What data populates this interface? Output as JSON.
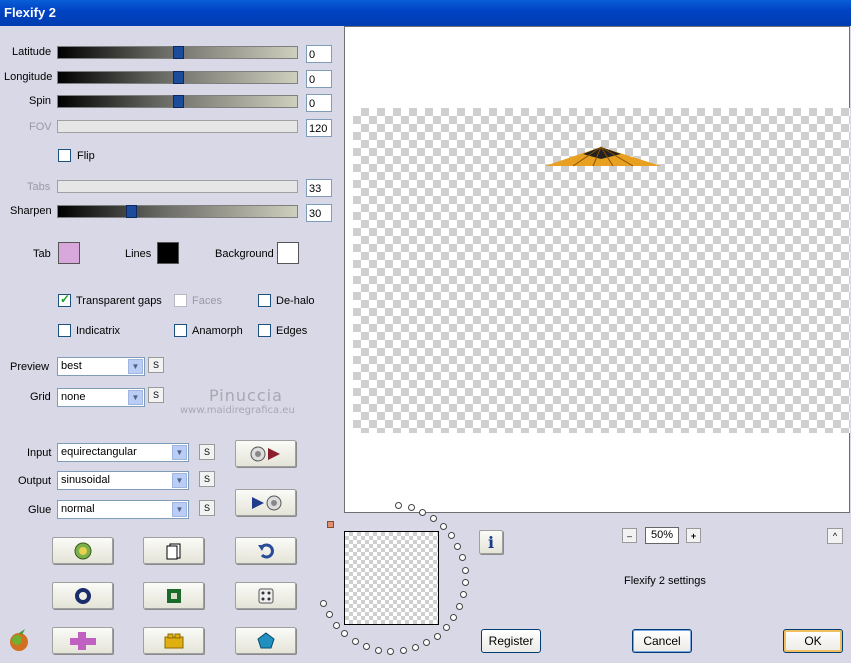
{
  "window": {
    "title": "Flexify 2"
  },
  "sliders": [
    {
      "label": "Latitude",
      "value": "0",
      "level": 0.5
    },
    {
      "label": "Longitude",
      "value": "0",
      "level": 0.5
    },
    {
      "label": "Spin",
      "value": "0",
      "level": 0.5
    },
    {
      "label": "FOV",
      "value": "120",
      "level": 0
    },
    {
      "label": "Tabs",
      "value": "33",
      "level": 0
    },
    {
      "label": "Sharpen",
      "value": "30",
      "level": 0.3
    }
  ],
  "flip": {
    "label": "Flip",
    "checked": false
  },
  "colors": {
    "tab": {
      "label": "Tab",
      "color": "#d8a8dc"
    },
    "lines": {
      "label": "Lines",
      "color": "#000000"
    },
    "background": {
      "label": "Background",
      "color": "#ffffff"
    }
  },
  "options": {
    "transparent_gaps": {
      "label": "Transparent gaps",
      "checked": true
    },
    "faces": {
      "label": "Faces",
      "checked": false
    },
    "de_halo": {
      "label": "De-halo",
      "checked": false
    },
    "indicatrix": {
      "label": "Indicatrix",
      "checked": false
    },
    "anamorph": {
      "label": "Anamorph",
      "checked": false
    },
    "edges": {
      "label": "Edges",
      "checked": false
    }
  },
  "preview": {
    "label": "Preview",
    "value": "best"
  },
  "grid": {
    "label": "Grid",
    "value": "none"
  },
  "input": {
    "label": "Input",
    "value": "equirectangular"
  },
  "output": {
    "label": "Output",
    "value": "sinusoidal"
  },
  "glue": {
    "label": "Glue",
    "value": "normal"
  },
  "s_label": "S",
  "watermark": {
    "name": "Pinuccia",
    "url": "www.maidiregrafica.eu"
  },
  "zoom": {
    "value": "50%",
    "minus": "–",
    "plus": "+"
  },
  "status_text": "Flexify 2 settings",
  "info_label": "i",
  "caret_label": "^",
  "buttons": {
    "register": "Register",
    "cancel": "Cancel",
    "ok": "OK"
  }
}
